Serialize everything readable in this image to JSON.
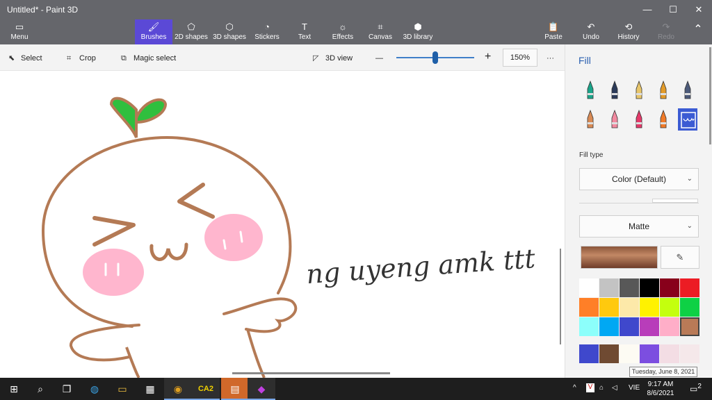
{
  "window": {
    "title": "Untitled* - Paint 3D"
  },
  "window_controls": [
    "—",
    "☐",
    "✕"
  ],
  "ribbon": {
    "menu": "Menu",
    "tabs": [
      {
        "label": "Brushes",
        "icon": "brush-icon",
        "glyph": "🖌"
      },
      {
        "label": "2D shapes",
        "icon": "shapes-2d-icon",
        "glyph": "⬠"
      },
      {
        "label": "3D shapes",
        "icon": "cube-icon",
        "glyph": "⬡"
      },
      {
        "label": "Stickers",
        "icon": "sticker-icon",
        "glyph": "◔"
      },
      {
        "label": "Text",
        "icon": "text-icon",
        "glyph": "T"
      },
      {
        "label": "Effects",
        "icon": "effects-icon",
        "glyph": "☼"
      },
      {
        "label": "Canvas",
        "icon": "canvas-icon",
        "glyph": "⌗"
      },
      {
        "label": "3D library",
        "icon": "library-icon",
        "glyph": "⬢"
      }
    ],
    "active_tab": "Brushes",
    "right": [
      {
        "label": "Paste",
        "icon": "paste-icon",
        "glyph": "📋"
      },
      {
        "label": "Undo",
        "icon": "undo-icon",
        "glyph": "↶"
      },
      {
        "label": "History",
        "icon": "history-icon",
        "glyph": "⟲"
      },
      {
        "label": "Redo",
        "icon": "redo-icon",
        "glyph": "↷"
      }
    ],
    "collapse_glyph": "⌃"
  },
  "toolstrip": {
    "select": "Select",
    "crop": "Crop",
    "magic_select": "Magic select",
    "view_3d": "3D view",
    "zoom_minus": "—",
    "zoom_plus": "+",
    "zoom_level": "150%",
    "zoom_fraction": 0.5,
    "more": "···"
  },
  "canvas": {
    "signature_text": "ng uyeng amk ttt"
  },
  "panel": {
    "title": "Fill",
    "brushes": [
      {
        "name": "marker",
        "color": "#1aa58a"
      },
      {
        "name": "calligraphy-pen",
        "color": "#2b3a58"
      },
      {
        "name": "oil-brush",
        "color": "#e8c66a"
      },
      {
        "name": "watercolor",
        "color": "#e39b2a"
      },
      {
        "name": "pixel-pen",
        "color": "#4c5a7a"
      },
      {
        "name": "pencil",
        "color": "#d98a54"
      },
      {
        "name": "eraser",
        "color": "#f28aa0"
      },
      {
        "name": "crayon",
        "color": "#e53a6a"
      },
      {
        "name": "spray-can",
        "color": "#f07a28"
      },
      {
        "name": "fill",
        "color": "#3b5bd3"
      }
    ],
    "fill_type_label": "Fill type",
    "fill_type_value": "Color (Default)",
    "material_value": "Matte",
    "eyedropper_glyph": "✎",
    "palette": [
      "#ffffff",
      "#c3c3c3",
      "#585858",
      "#000000",
      "#88001b",
      "#ec1c24",
      "#ff7f27",
      "#ffc90e",
      "#fde9a9",
      "#fff200",
      "#c4ff0e",
      "#0ed145",
      "#8cfffb",
      "#00a8f3",
      "#3f48cc",
      "#b83dba",
      "#ffaec8",
      "#b97a57"
    ],
    "selected_color": "#b97a57",
    "custom_colors": [
      "#3f48cc",
      "#6f4a32",
      "#fdfbf3",
      "#7c4ee0",
      "#f3dde4",
      "#f5e8ea"
    ],
    "accent_color": "#5b49d6"
  },
  "taskbar": {
    "apps": [
      {
        "name": "start-icon",
        "glyph": "⊞"
      },
      {
        "name": "search-icon",
        "glyph": "⌕"
      },
      {
        "name": "task-view-icon",
        "glyph": "❐"
      },
      {
        "name": "edge-icon",
        "glyph": "◍"
      },
      {
        "name": "file-explorer-icon",
        "glyph": "▭"
      },
      {
        "name": "store-icon",
        "glyph": "▦"
      },
      {
        "name": "chrome-icon",
        "glyph": "◉"
      },
      {
        "name": "ca2-icon",
        "glyph": "CA2"
      },
      {
        "name": "calculator-icon",
        "glyph": "▤"
      },
      {
        "name": "paint3d-icon",
        "glyph": "◆"
      }
    ],
    "tray": {
      "chevron": "^",
      "lang": "VIE",
      "time": "9:17 AM",
      "date": "8/6/2021",
      "notifications": "2"
    },
    "tooltip": "Tuesday, June 8, 2021"
  }
}
